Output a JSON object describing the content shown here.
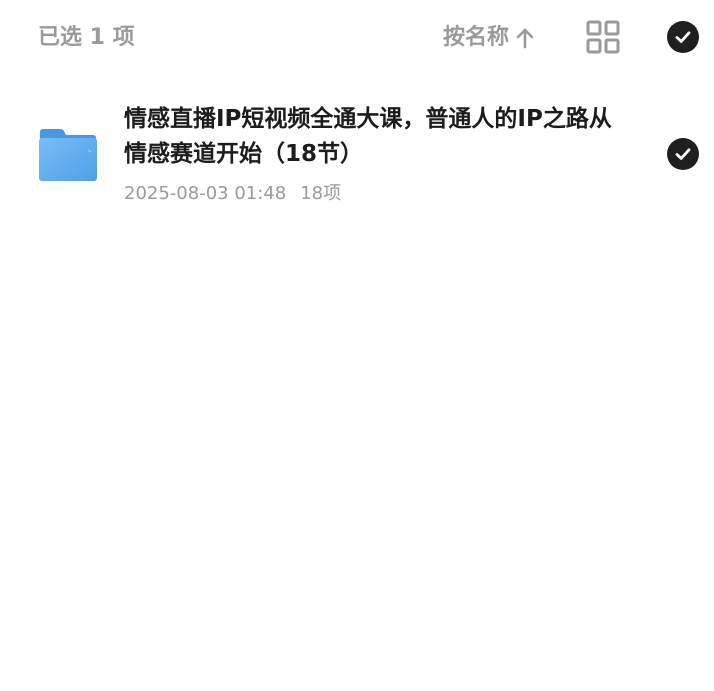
{
  "header": {
    "selected_label": "已选 1 项",
    "sort_label": "按名称",
    "sort_direction_icon": "arrow-up-icon",
    "view_toggle_icon": "grid-view-icon",
    "select_all_icon": "check-icon"
  },
  "files": [
    {
      "name": "情感直播IP短视频全通大课，普通人的IP之路从情感赛道开始（18节）",
      "date": "2025-08-03 01:48",
      "count": "18项",
      "icon": "folder-icon",
      "selected": true
    }
  ],
  "colors": {
    "muted_text": "#9a9a9a",
    "primary_text": "#1c1c1c",
    "check_bg": "#1f1f1f",
    "folder_blue": "#5aaaf0"
  }
}
